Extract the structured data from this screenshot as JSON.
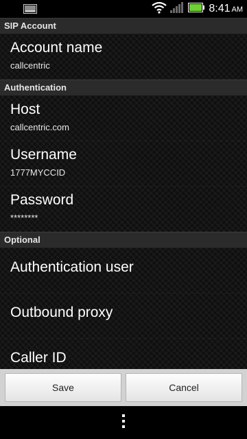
{
  "status_bar": {
    "time": "8:41",
    "time_suffix": "AM",
    "icons": [
      "notification-icon",
      "wifi-icon",
      "signal-icon",
      "battery-icon"
    ],
    "battery_color": "#6fd133"
  },
  "sections": [
    {
      "header": "SIP Account",
      "items": [
        {
          "title": "Account name",
          "summary": "callcentric"
        }
      ]
    },
    {
      "header": "Authentication",
      "items": [
        {
          "title": "Host",
          "summary": "callcentric.com"
        },
        {
          "title": "Username",
          "summary": "1777MYCCID"
        },
        {
          "title": "Password",
          "summary": "********"
        }
      ]
    },
    {
      "header": "Optional",
      "items": [
        {
          "title": "Authentication user"
        },
        {
          "title": "Outbound proxy"
        },
        {
          "title": "Caller ID"
        }
      ]
    }
  ],
  "buttons": {
    "save_label": "Save",
    "cancel_label": "Cancel"
  },
  "nav_bar": {
    "icons": [
      "overflow-menu-icon"
    ]
  }
}
